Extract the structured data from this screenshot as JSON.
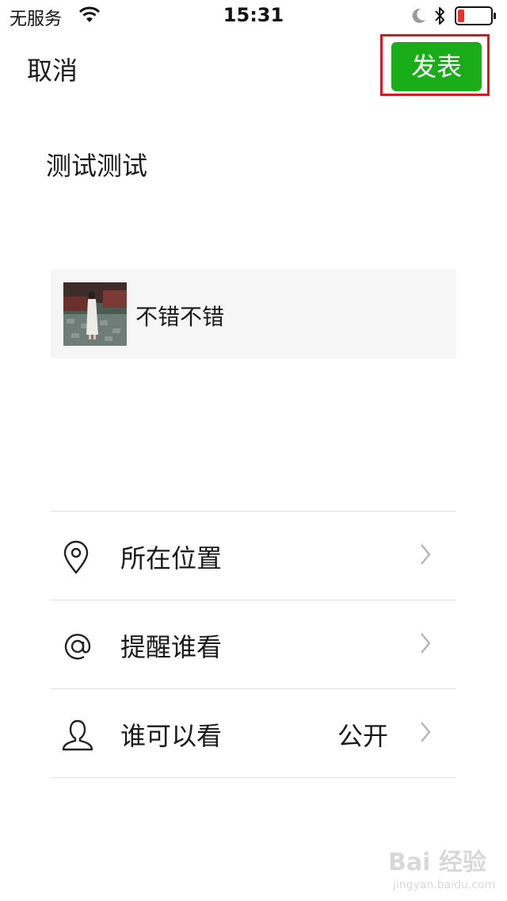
{
  "status_bar": {
    "carrier": "无服务",
    "time": "15:31",
    "icons": [
      "wifi-icon",
      "moon-icon",
      "bluetooth-icon",
      "battery-icon"
    ],
    "battery_color": "#e8322e"
  },
  "nav": {
    "cancel_label": "取消",
    "publish_label": "发表",
    "publish_color": "#1aad19",
    "highlight_color": "#d8181f"
  },
  "post": {
    "text": "测试测试"
  },
  "link_card": {
    "title": "不错不错"
  },
  "options": [
    {
      "icon": "location-pin-icon",
      "label": "所在位置",
      "value": ""
    },
    {
      "icon": "at-sign-icon",
      "label": "提醒谁看",
      "value": ""
    },
    {
      "icon": "person-icon",
      "label": "谁可以看",
      "value": "公开"
    }
  ],
  "watermark": {
    "main": "Bai 经验",
    "sub": "jingyan.baidu.com"
  }
}
